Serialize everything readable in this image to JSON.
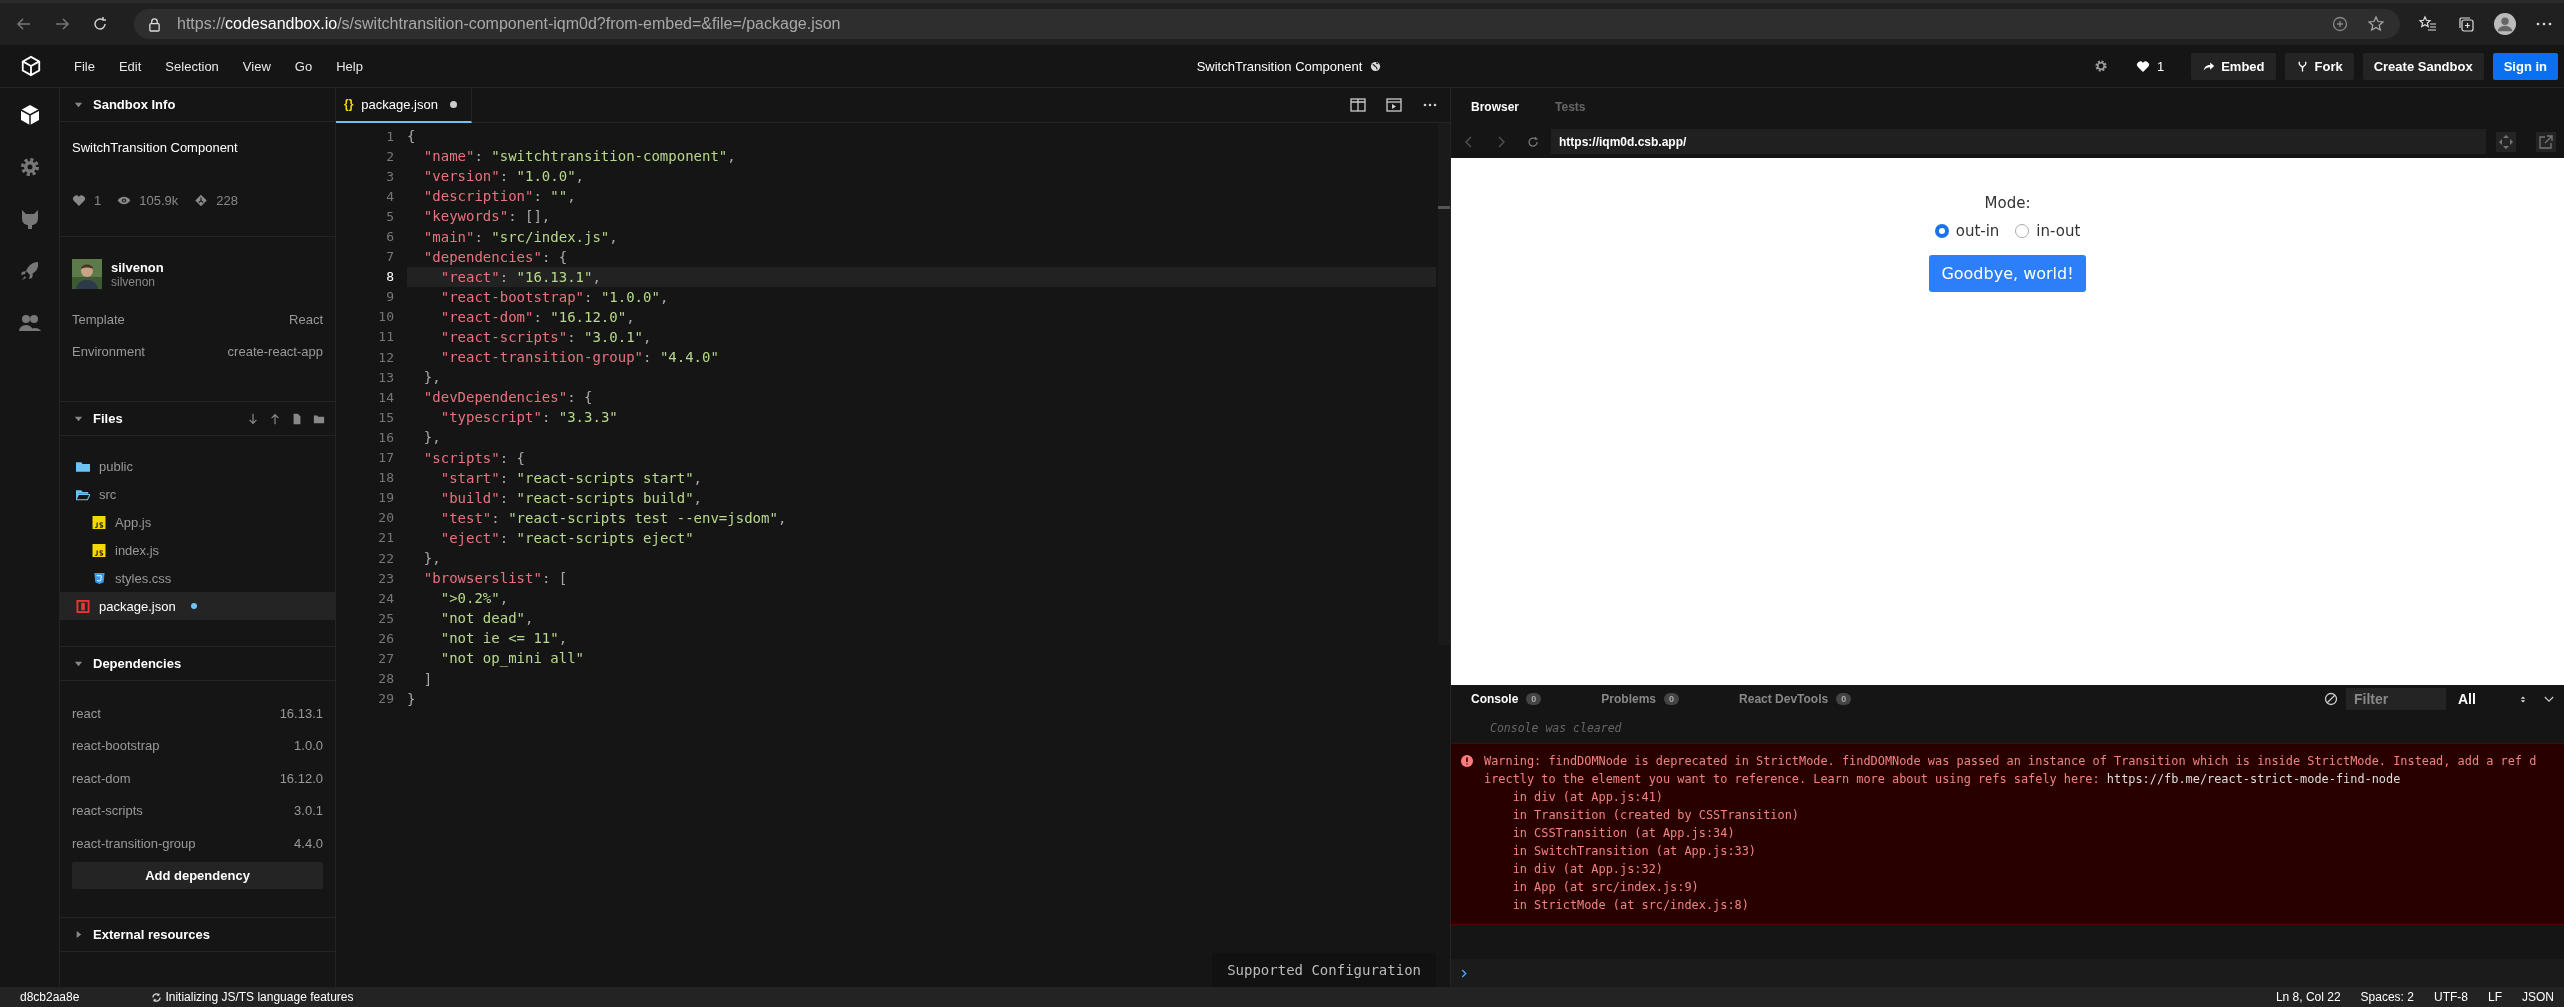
{
  "browser_chrome": {
    "url": {
      "scheme": "https://",
      "host": "codesandbox.io",
      "path": "/s/switchtransition-component-iqm0d?from-embed=&file=/package.json"
    }
  },
  "header": {
    "menu": [
      "File",
      "Edit",
      "Selection",
      "View",
      "Go",
      "Help"
    ],
    "title": "SwitchTransition Component",
    "likes": "1",
    "buttons": [
      {
        "label": "Embed",
        "kind": "embed"
      },
      {
        "label": "Fork",
        "kind": "fork"
      },
      {
        "label": "Create Sandbox",
        "kind": "plain"
      },
      {
        "label": "Sign in",
        "kind": "primary"
      }
    ]
  },
  "activity_bar": {
    "items": [
      {
        "selected": true
      },
      {
        "selected": false
      },
      {
        "selected": false
      },
      {
        "selected": false
      },
      {
        "selected": false
      }
    ]
  },
  "sidebar": {
    "sandbox_info": {
      "title": "Sandbox Info",
      "expanded": true,
      "name": "SwitchTransition Component",
      "likes": "1",
      "views": "105.9k",
      "forks": "228",
      "author": {
        "name": "silvenon",
        "username": "silvenon"
      },
      "details": [
        {
          "label": "Template",
          "value": "React"
        },
        {
          "label": "Environment",
          "value": "create-react-app"
        }
      ]
    },
    "files": {
      "title": "Files",
      "expanded": true,
      "tree": [
        {
          "name": "public",
          "kind": "folder",
          "expanded": false,
          "selected": false,
          "modified": false
        },
        {
          "name": "src",
          "kind": "folder",
          "expanded": true,
          "selected": false,
          "modified": false,
          "children": [
            {
              "name": "App.js",
              "kind": "js",
              "selected": false,
              "modified": false
            },
            {
              "name": "index.js",
              "kind": "js",
              "selected": false,
              "modified": false
            },
            {
              "name": "styles.css",
              "kind": "css",
              "selected": false,
              "modified": false
            }
          ]
        },
        {
          "name": "package.json",
          "kind": "json",
          "selected": true,
          "modified": true
        }
      ]
    },
    "dependencies": {
      "title": "Dependencies",
      "expanded": true,
      "items": [
        {
          "name": "react",
          "version": "16.13.1"
        },
        {
          "name": "react-bootstrap",
          "version": "1.0.0"
        },
        {
          "name": "react-dom",
          "version": "16.12.0"
        },
        {
          "name": "react-scripts",
          "version": "3.0.1"
        },
        {
          "name": "react-transition-group",
          "version": "4.4.0"
        }
      ],
      "button": "Add dependency"
    },
    "external_resources": {
      "title": "External resources",
      "expanded": false
    }
  },
  "editor": {
    "tab": {
      "icon": "{}",
      "label": "package.json",
      "modified": true,
      "selected": true
    },
    "lines": [
      {
        "number": "1",
        "code": "{",
        "current": false
      },
      {
        "number": "2",
        "code": "  \"name\": \"switchtransition-component\",",
        "current": false
      },
      {
        "number": "3",
        "code": "  \"version\": \"1.0.0\",",
        "current": false
      },
      {
        "number": "4",
        "code": "  \"description\": \"\",",
        "current": false
      },
      {
        "number": "5",
        "code": "  \"keywords\": [],",
        "current": false
      },
      {
        "number": "6",
        "code": "  \"main\": \"src/index.js\",",
        "current": false
      },
      {
        "number": "7",
        "code": "  \"dependencies\": {",
        "current": false
      },
      {
        "number": "8",
        "code": "    \"react\": \"16.13.1\",",
        "current": true
      },
      {
        "number": "9",
        "code": "    \"react-bootstrap\": \"1.0.0\",",
        "current": false
      },
      {
        "number": "10",
        "code": "    \"react-dom\": \"16.12.0\",",
        "current": false
      },
      {
        "number": "11",
        "code": "    \"react-scripts\": \"3.0.1\",",
        "current": false
      },
      {
        "number": "12",
        "code": "    \"react-transition-group\": \"4.4.0\"",
        "current": false
      },
      {
        "number": "13",
        "code": "  },",
        "current": false
      },
      {
        "number": "14",
        "code": "  \"devDependencies\": {",
        "current": false
      },
      {
        "number": "15",
        "code": "    \"typescript\": \"3.3.3\"",
        "current": false
      },
      {
        "number": "16",
        "code": "  },",
        "current": false
      },
      {
        "number": "17",
        "code": "  \"scripts\": {",
        "current": false
      },
      {
        "number": "18",
        "code": "    \"start\": \"react-scripts start\",",
        "current": false
      },
      {
        "number": "19",
        "code": "    \"build\": \"react-scripts build\",",
        "current": false
      },
      {
        "number": "20",
        "code": "    \"test\": \"react-scripts test --env=jsdom\",",
        "current": false
      },
      {
        "number": "21",
        "code": "    \"eject\": \"react-scripts eject\"",
        "current": false
      },
      {
        "number": "22",
        "code": "  },",
        "current": false
      },
      {
        "number": "23",
        "code": "  \"browserslist\": [",
        "current": false
      },
      {
        "number": "24",
        "code": "    \">0.2%\",",
        "current": false
      },
      {
        "number": "25",
        "code": "    \"not dead\",",
        "current": false
      },
      {
        "number": "26",
        "code": "    \"not ie <= 11\",",
        "current": false
      },
      {
        "number": "27",
        "code": "    \"not op_mini all\"",
        "current": false
      },
      {
        "number": "28",
        "code": "  ]",
        "current": false
      },
      {
        "number": "29",
        "code": "}",
        "current": false
      }
    ],
    "notice": "Supported Configuration"
  },
  "preview_pane": {
    "tabs": [
      {
        "label": "Browser",
        "selected": true
      },
      {
        "label": "Tests",
        "selected": false
      }
    ],
    "url": "https://iqm0d.csb.app/",
    "page": {
      "label": "Mode:",
      "radios": [
        {
          "label": "out-in",
          "selected": true
        },
        {
          "label": "in-out",
          "selected": false
        }
      ],
      "button": "Goodbye, world!"
    }
  },
  "console": {
    "tabs": [
      {
        "label": "Console",
        "count": "0",
        "selected": true
      },
      {
        "label": "Problems",
        "count": "0",
        "selected": false
      },
      {
        "label": "React DevTools",
        "count": "0",
        "selected": false
      }
    ],
    "filter_placeholder": "Filter",
    "level": "All",
    "cleared": "Console was cleared",
    "error": {
      "message": "Warning: findDOMNode is deprecated in StrictMode. findDOMNode was passed an instance of Transition which is inside StrictMode. Instead, add a ref directly to the element you want to reference. Learn more about using refs safely here: ",
      "link": "https://fb.me/react-strict-mode-find-node",
      "stack": [
        "in div (at App.js:41)",
        "in Transition (created by CSSTransition)",
        "in CSSTransition (at App.js:34)",
        "in SwitchTransition (at App.js:33)",
        "in div (at App.js:32)",
        "in App (at src/index.js:9)",
        "in StrictMode (at src/index.js:8)"
      ]
    }
  },
  "status_bar": {
    "commit": "d8cb2aa8e",
    "message": "Initializing JS/TS language features",
    "items": [
      "Ln 8, Col 22",
      "Spaces: 2",
      "UTF-8",
      "LF",
      "JSON"
    ]
  }
}
